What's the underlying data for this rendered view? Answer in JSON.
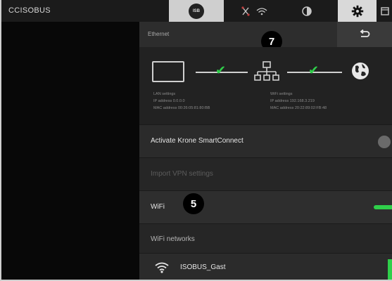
{
  "app": {
    "brand": "CCISOBUS"
  },
  "topbar": {
    "tabs": [
      {
        "id": "isobus",
        "label": "ISB",
        "icon": "isobus-icon",
        "active": true
      },
      {
        "id": "network",
        "icon": "network-signal-icon"
      },
      {
        "id": "info",
        "icon": "info-icon"
      },
      {
        "id": "settings",
        "icon": "gear-icon",
        "active": true
      },
      {
        "id": "extra",
        "icon": "window-icon"
      }
    ]
  },
  "panel": {
    "title": "Ethernet",
    "back_icon": "back-arrow-icon",
    "markers": [
      "7",
      "5"
    ],
    "diagram": {
      "lan": {
        "title": "LAN settings",
        "ip": "IP address 0.0.0.0",
        "mac": "MAC address 00:26:05:81:80:BB"
      },
      "wifi": {
        "title": "WiFi settings",
        "ip": "IP address 192.168.3.219",
        "mac": "MAC address 20:22:89:02:FB:48"
      },
      "status_color": "#2fcf4a"
    },
    "rows": {
      "activate": {
        "label": "Activate Krone SmartConnect",
        "toggle": false
      },
      "import_vpn": {
        "label": "Import VPN settings",
        "enabled": false
      },
      "wifi": {
        "label": "WiFi",
        "toggle": true
      },
      "networks": {
        "label": "WiFi networks"
      },
      "ssid": {
        "label": "ISOBUS_Gast",
        "icon": "wifi-icon"
      }
    }
  }
}
